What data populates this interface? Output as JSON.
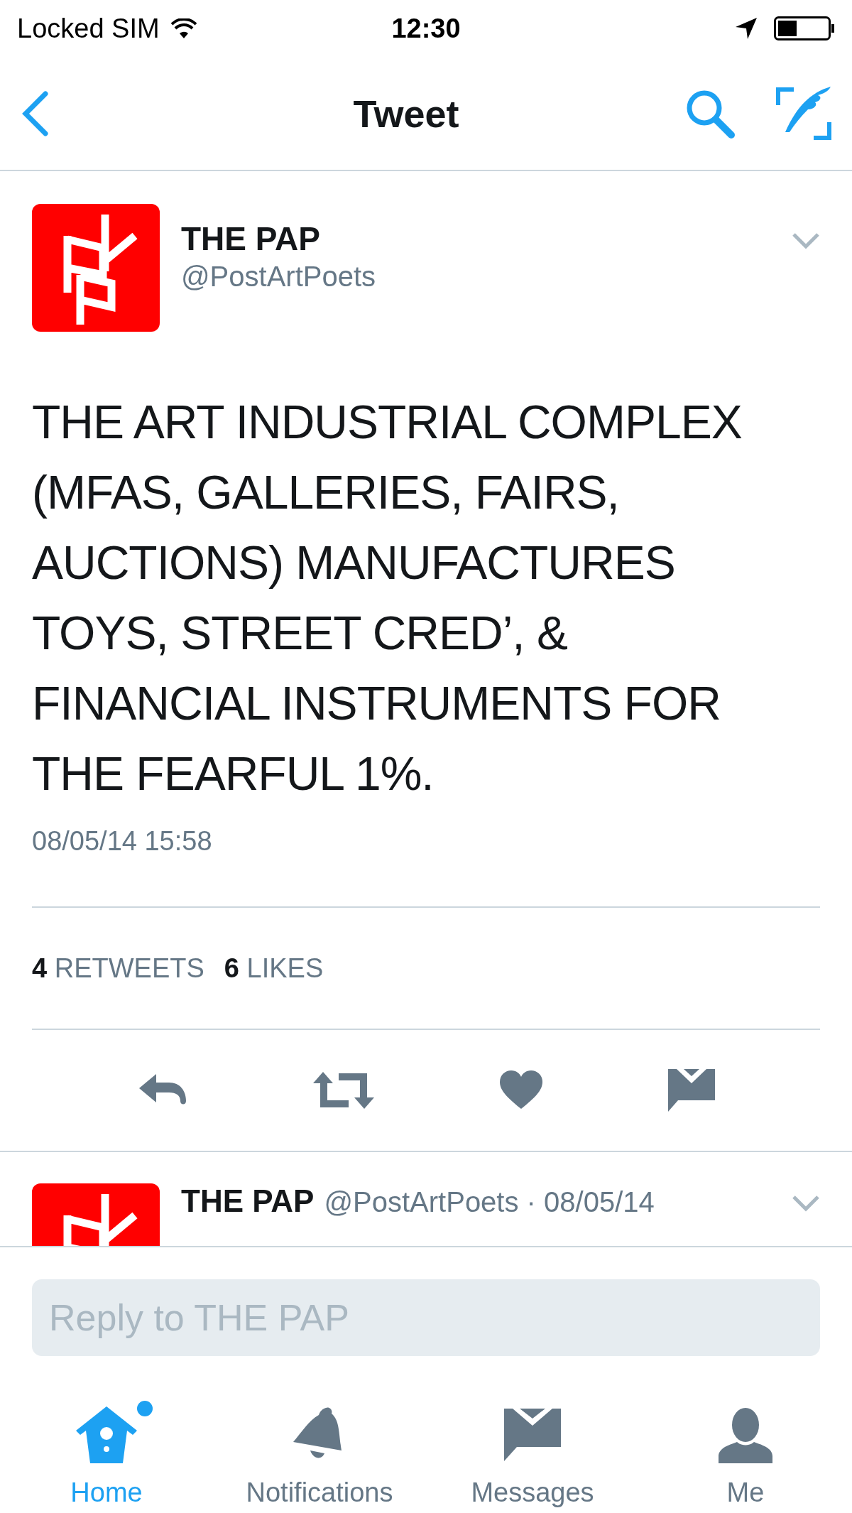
{
  "status_bar": {
    "carrier": "Locked SIM",
    "time": "12:30"
  },
  "nav": {
    "title": "Tweet"
  },
  "tweet": {
    "name": "THE PAP",
    "handle": "@PostArtPoets",
    "text": "THE ART INDUSTRIAL COMPLEX (MFAS, GALLERIES, FAIRS, AUCTIONS) MANUFACTURES TOYS, STREET CRED’, & FINANCIAL INSTRUMENTS FOR THE FEARFUL 1%.",
    "timestamp": "08/05/14 15:58",
    "stats": [
      {
        "count": "4",
        "label": "RETWEETS"
      },
      {
        "count": "6",
        "label": "LIKES"
      }
    ]
  },
  "actions": [
    {
      "kind": "reply"
    },
    {
      "kind": "retweet"
    },
    {
      "kind": "like"
    },
    {
      "kind": "message"
    }
  ],
  "next_tweet": {
    "name": "THE PAP",
    "meta": "@PostArtPoets · 08/05/14"
  },
  "reply": {
    "placeholder": "Reply to THE PAP"
  },
  "tabs": [
    {
      "kind": "home",
      "label": "Home",
      "selected": true,
      "unread": true
    },
    {
      "kind": "notifications",
      "label": "Notifications",
      "selected": false,
      "unread": false
    },
    {
      "kind": "messages",
      "label": "Messages",
      "selected": false,
      "unread": false
    },
    {
      "kind": "me",
      "label": "Me",
      "selected": false,
      "unread": false
    }
  ]
}
